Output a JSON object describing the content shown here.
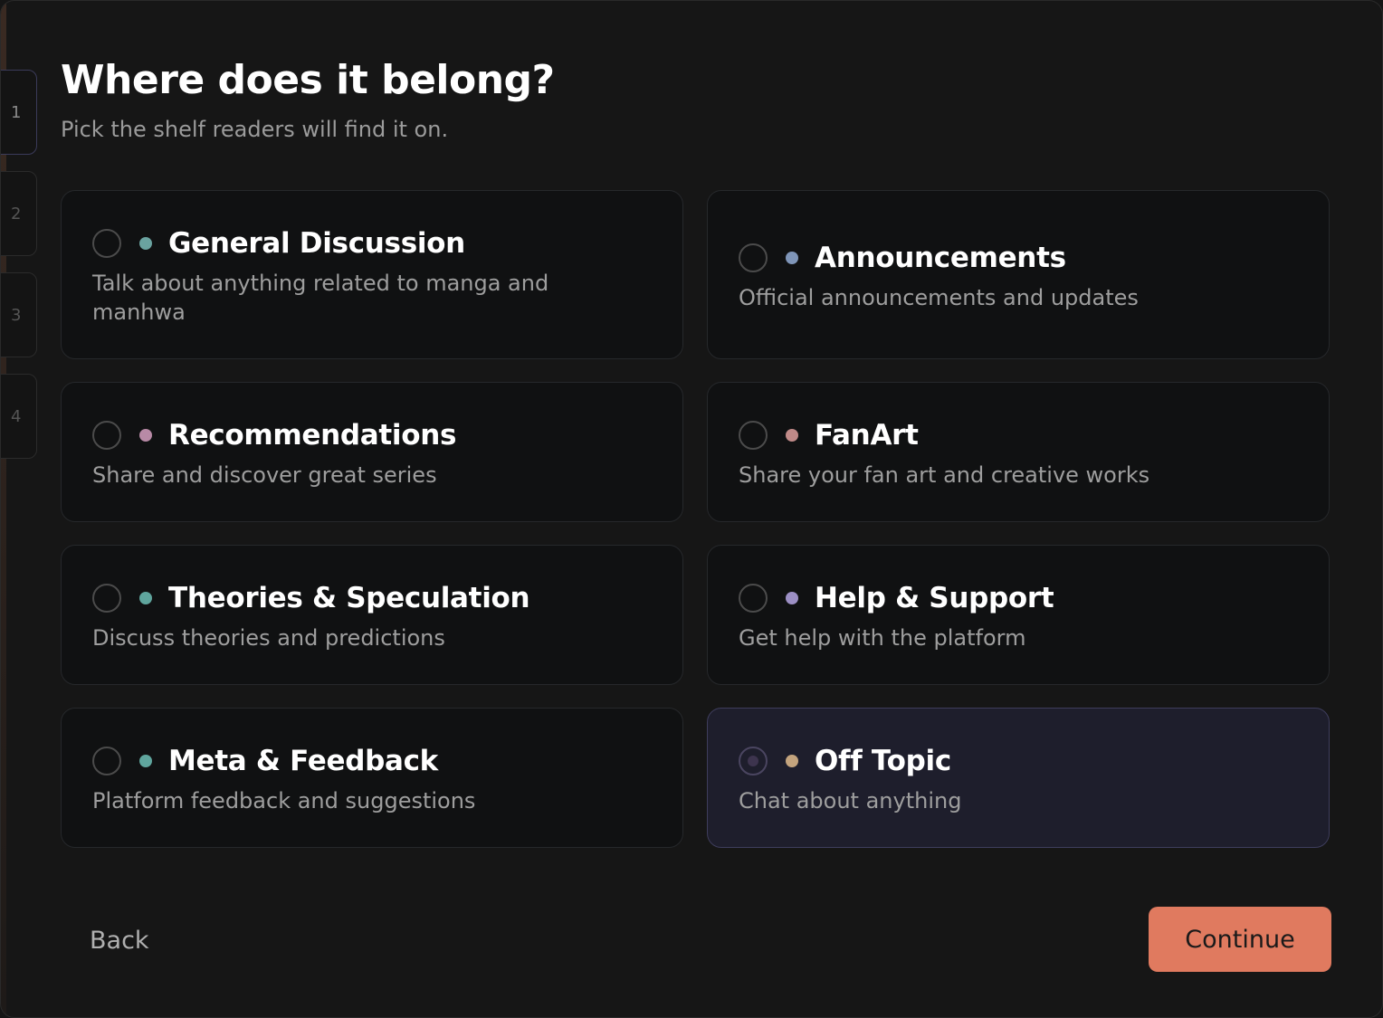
{
  "header": {
    "title": "Where does it belong?",
    "subtitle": "Pick the shelf readers will find it on."
  },
  "steps": [
    "1",
    "2",
    "3",
    "4"
  ],
  "categories": [
    {
      "title": "General Discussion",
      "description": "Talk about anything related to manga and manhwa",
      "dot_color": "#6aa3a0",
      "selected": false
    },
    {
      "title": "Announcements",
      "description": "Official announcements and updates",
      "dot_color": "#7f95b8",
      "selected": false
    },
    {
      "title": "Recommendations",
      "description": "Share and discover great series",
      "dot_color": "#b88aa6",
      "selected": false
    },
    {
      "title": "FanArt",
      "description": "Share your fan art and creative works",
      "dot_color": "#c08a88",
      "selected": false
    },
    {
      "title": "Theories & Speculation",
      "description": "Discuss theories and predictions",
      "dot_color": "#5fa59d",
      "selected": false
    },
    {
      "title": "Help & Support",
      "description": "Get help with the platform",
      "dot_color": "#9c8fc4",
      "selected": false
    },
    {
      "title": "Meta & Feedback",
      "description": "Platform feedback and suggestions",
      "dot_color": "#5fa59d",
      "selected": false
    },
    {
      "title": "Off Topic",
      "description": "Chat about anything",
      "dot_color": "#c4a47e",
      "selected": true
    }
  ],
  "footer": {
    "back_label": "Back",
    "continue_label": "Continue"
  },
  "colors": {
    "accent": "#e07a5f",
    "selected_card_bg": "#1e1e2c"
  }
}
